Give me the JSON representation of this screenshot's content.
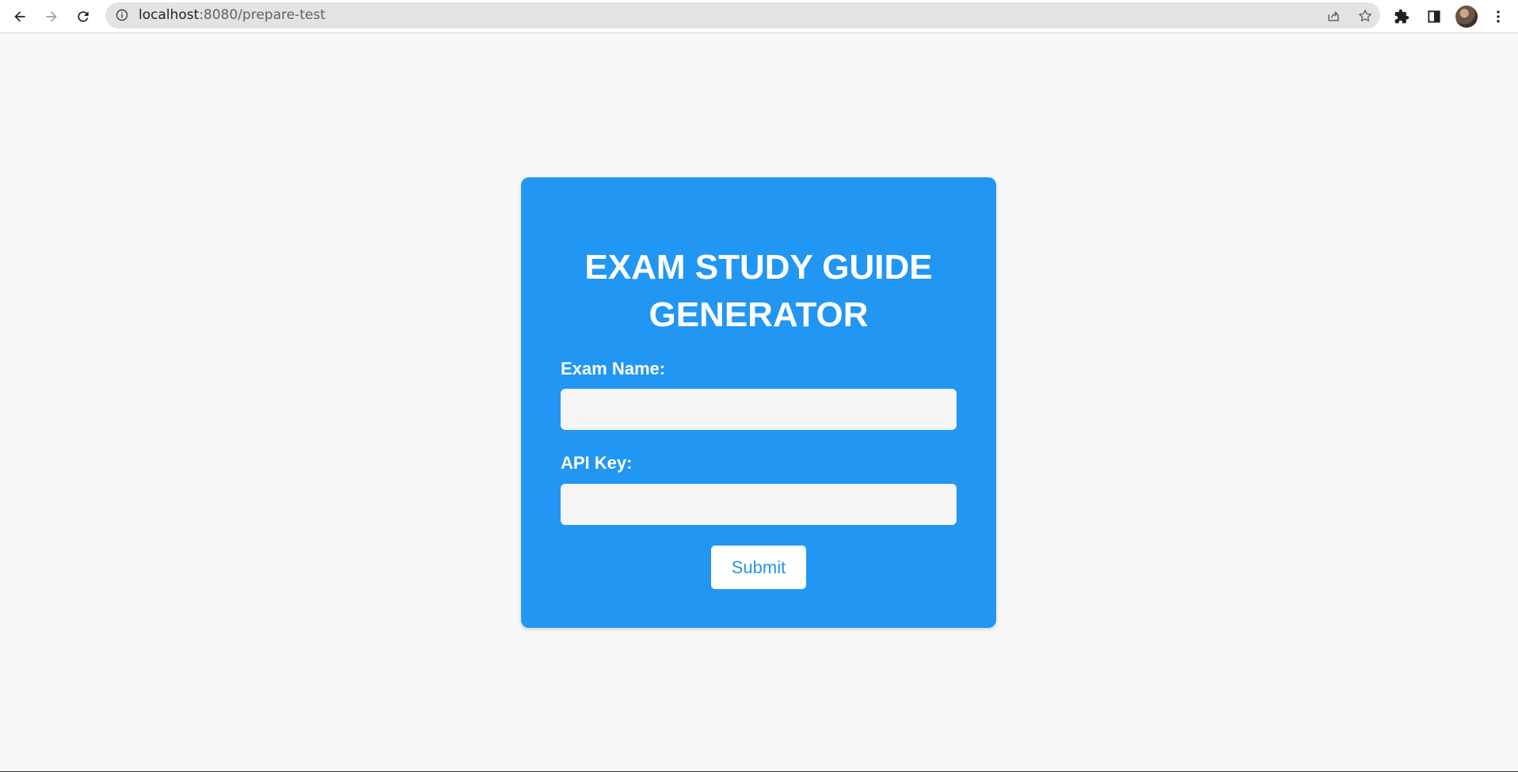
{
  "browser": {
    "url_host": "localhost",
    "url_path": ":8080/prepare-test",
    "icons": {
      "back": "arrow-left-icon",
      "forward": "arrow-right-icon",
      "reload": "reload-icon",
      "site_info": "info-icon",
      "share": "share-icon",
      "bookmark": "star-icon",
      "extensions": "puzzle-icon",
      "side_panel": "side-panel-icon",
      "profile": "avatar",
      "menu": "kebab-menu-icon"
    }
  },
  "form": {
    "title": "EXAM STUDY GUIDE GENERATOR",
    "exam_name_label": "Exam Name:",
    "exam_name_value": "",
    "api_key_label": "API Key:",
    "api_key_value": "",
    "submit_label": "Submit"
  },
  "colors": {
    "card_background": "#2196f3",
    "page_background": "#f8f8f8",
    "input_background": "#f5f5f5",
    "button_text": "#2196f3"
  }
}
